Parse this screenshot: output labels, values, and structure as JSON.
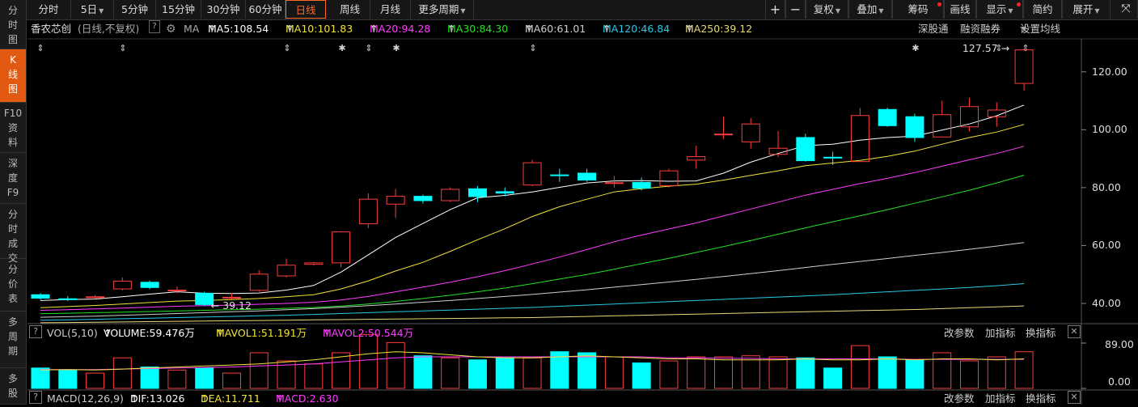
{
  "sidebar": {
    "items": [
      {
        "label": "分\n时\n图",
        "active": false
      },
      {
        "label": "K\n线\n图",
        "active": true
      },
      {
        "label": "F10\n资\n料",
        "active": false
      },
      {
        "label": "深\n度\nF9",
        "active": false
      },
      {
        "label": "分\n时\n成\n交",
        "active": false
      },
      {
        "label": "分\n价\n表",
        "active": false
      },
      {
        "label": "多\n周\n期",
        "active": false
      },
      {
        "label": "多\n股",
        "active": false
      }
    ]
  },
  "toolbar": {
    "periods": [
      "分时",
      "5日",
      "5分钟",
      "15分钟",
      "30分钟",
      "60分钟",
      "日线",
      "周线",
      "月线",
      "更多周期"
    ],
    "active_period": "日线",
    "right_buttons": [
      "+",
      "−",
      "复权",
      "叠加",
      "筹码",
      "画线",
      "显示",
      "简约",
      "展开"
    ]
  },
  "infobar": {
    "stock_name": "香农芯创",
    "mode": "(日线,不复权)",
    "help": "?",
    "ma_label": "MA",
    "ma": [
      {
        "text": "MA5:108.54",
        "color": "#ffffff"
      },
      {
        "text": "MA10:101.83",
        "color": "#f2e33a"
      },
      {
        "text": "MA20:94.28",
        "color": "#ff3dff"
      },
      {
        "text": "MA30:84.30",
        "color": "#25e025"
      },
      {
        "text": "MA60:61.01",
        "color": "#cfcfcf"
      },
      {
        "text": "MA120:46.84",
        "color": "#29c8e6"
      },
      {
        "text": "MA250:39.12",
        "color": "#e8d97a"
      }
    ],
    "links": [
      "深股通",
      "融资融券",
      "设置均线"
    ]
  },
  "price_axis": {
    "labels": [
      "120.00",
      "100.00",
      "80.00",
      "60.00",
      "40.00"
    ]
  },
  "price_annotations": {
    "high": "127.57",
    "low": "39.12"
  },
  "volume_panel": {
    "title": "VOL(5,10)",
    "volume": "VOLUME:59.476万",
    "mavol1": "MAVOL1:51.191万",
    "mavol2": "MAVOL2:50.544万",
    "links": [
      "改参数",
      "加指标",
      "换指标"
    ],
    "axis_labels": [
      "89.00",
      "0.00"
    ]
  },
  "macd_panel": {
    "title": "MACD(12,26,9)",
    "dif": "DIF:13.026",
    "dea": "DEA:11.711",
    "macd": "MACD:2.630",
    "links": [
      "改参数",
      "加指标",
      "换指标"
    ]
  },
  "colors": {
    "up": "#ff3d3d",
    "down": "#00ffff",
    "accent": "#ff6a2a"
  },
  "chart_data": {
    "type": "candlestick",
    "ylim": [
      33,
      130
    ],
    "candles": [
      {
        "o": 43.0,
        "c": 41.8,
        "h": 43.5,
        "l": 41.2
      },
      {
        "o": 41.6,
        "c": 41.4,
        "h": 42.5,
        "l": 40.8
      },
      {
        "o": 42.0,
        "c": 42.3,
        "h": 42.9,
        "l": 41.5
      },
      {
        "o": 45.0,
        "c": 47.7,
        "h": 48.9,
        "l": 44.5
      },
      {
        "o": 47.3,
        "c": 45.5,
        "h": 47.9,
        "l": 44.9
      },
      {
        "o": 44.5,
        "c": 44.6,
        "h": 45.8,
        "l": 43.5
      },
      {
        "o": 43.5,
        "c": 39.6,
        "h": 44.0,
        "l": 39.12
      },
      {
        "o": 42.0,
        "c": 42.1,
        "h": 43.5,
        "l": 41.4
      },
      {
        "o": 44.5,
        "c": 50.1,
        "h": 51.5,
        "l": 44.0
      },
      {
        "o": 49.5,
        "c": 53.2,
        "h": 55.5,
        "l": 49.0
      },
      {
        "o": 53.5,
        "c": 54.0,
        "h": 54.3,
        "l": 53.1
      },
      {
        "o": 54.0,
        "c": 64.7,
        "h": 65.0,
        "l": 52.5
      },
      {
        "o": 67.5,
        "c": 76.0,
        "h": 78.0,
        "l": 66.0
      },
      {
        "o": 74.3,
        "c": 77.0,
        "h": 79.5,
        "l": 69.5
      },
      {
        "o": 77.0,
        "c": 75.5,
        "h": 77.6,
        "l": 74.5
      },
      {
        "o": 75.5,
        "c": 79.4,
        "h": 80.1,
        "l": 75.0
      },
      {
        "o": 79.6,
        "c": 76.9,
        "h": 80.5,
        "l": 75.0
      },
      {
        "o": 78.6,
        "c": 78.1,
        "h": 80.1,
        "l": 77.0
      },
      {
        "o": 80.9,
        "c": 88.6,
        "h": 89.6,
        "l": 80.5
      },
      {
        "o": 84.4,
        "c": 84.2,
        "h": 86.5,
        "l": 82.0
      },
      {
        "o": 85.0,
        "c": 82.6,
        "h": 86.5,
        "l": 82.0
      },
      {
        "o": 81.5,
        "c": 81.7,
        "h": 84.0,
        "l": 80.0
      },
      {
        "o": 81.8,
        "c": 79.8,
        "h": 83.5,
        "l": 79.0
      },
      {
        "o": 80.7,
        "c": 85.8,
        "h": 86.5,
        "l": 80.0
      },
      {
        "o": 89.5,
        "c": 90.7,
        "h": 94.5,
        "l": 86.5
      },
      {
        "o": 98.5,
        "c": 98.5,
        "h": 104.5,
        "l": 96.8
      },
      {
        "o": 95.8,
        "c": 102.0,
        "h": 104.0,
        "l": 93.5
      },
      {
        "o": 91.5,
        "c": 93.6,
        "h": 99.5,
        "l": 90.5
      },
      {
        "o": 97.3,
        "c": 89.3,
        "h": 98.6,
        "l": 89.0
      },
      {
        "o": 90.5,
        "c": 90.3,
        "h": 92.4,
        "l": 87.8
      },
      {
        "o": 89.0,
        "c": 104.9,
        "h": 107.5,
        "l": 89.0
      },
      {
        "o": 107.0,
        "c": 101.4,
        "h": 107.6,
        "l": 101.0
      },
      {
        "o": 104.5,
        "c": 97.3,
        "h": 105.5,
        "l": 95.8
      },
      {
        "o": 97.5,
        "c": 105.2,
        "h": 110.0,
        "l": 97.3
      },
      {
        "o": 101.0,
        "c": 108.0,
        "h": 111.0,
        "l": 99.4
      },
      {
        "o": 104.5,
        "c": 106.8,
        "h": 109.5,
        "l": 101.0
      },
      {
        "o": 116.0,
        "c": 127.57,
        "h": 128.0,
        "l": 113.5
      }
    ],
    "ma5": [
      41.0,
      41.3,
      41.5,
      42.3,
      43.2,
      44.0,
      43.5,
      43.4,
      43.6,
      44.6,
      46.2,
      50.8,
      56.8,
      62.8,
      67.6,
      72.4,
      76.5,
      77.3,
      78.5,
      80.1,
      81.6,
      82.3,
      82.4,
      82.2,
      82.3,
      85.0,
      88.8,
      91.8,
      94.5,
      95.0,
      96.4,
      97.3,
      97.8,
      99.9,
      102.0,
      104.8,
      108.54
    ],
    "ma10": [
      38.5,
      38.9,
      39.3,
      39.8,
      40.3,
      40.8,
      41.0,
      41.3,
      41.7,
      42.3,
      43.0,
      45.0,
      47.8,
      51.2,
      54.2,
      58.0,
      62.0,
      65.8,
      70.0,
      73.4,
      76.0,
      78.5,
      79.6,
      80.5,
      81.2,
      82.6,
      84.2,
      85.8,
      87.6,
      88.5,
      89.4,
      90.8,
      92.6,
      95.0,
      97.3,
      99.2,
      101.83
    ],
    "ma20": [
      37.6,
      37.8,
      38.1,
      38.4,
      38.7,
      39.0,
      39.2,
      39.4,
      39.7,
      40.0,
      40.4,
      41.2,
      42.4,
      44.0,
      45.6,
      47.3,
      49.2,
      51.3,
      53.6,
      56.0,
      58.6,
      61.3,
      63.6,
      65.7,
      67.8,
      70.2,
      72.6,
      75.0,
      77.4,
      79.4,
      81.4,
      83.2,
      85.2,
      87.4,
      89.6,
      91.8,
      94.28
    ],
    "ma30": [
      36.4,
      36.6,
      36.8,
      37.0,
      37.2,
      37.4,
      37.6,
      37.8,
      38.0,
      38.3,
      38.6,
      39.1,
      39.8,
      40.7,
      41.7,
      42.8,
      44.0,
      45.3,
      46.8,
      48.4,
      50.0,
      51.8,
      53.7,
      55.6,
      57.6,
      59.6,
      61.7,
      63.9,
      66.1,
      68.2,
      70.3,
      72.4,
      74.6,
      76.8,
      79.1,
      81.6,
      84.3
    ],
    "ma60": [
      35.2,
      35.4,
      35.6,
      35.9,
      36.2,
      36.5,
      36.8,
      37.1,
      37.4,
      37.8,
      38.2,
      38.7,
      39.2,
      39.8,
      40.4,
      41.0,
      41.7,
      42.4,
      43.1,
      43.9,
      44.7,
      45.6,
      46.5,
      47.4,
      48.3,
      49.3,
      50.3,
      51.3,
      52.4,
      53.5,
      54.5,
      55.5,
      56.6,
      57.6,
      58.7,
      59.8,
      61.01
    ],
    "ma120": [
      34.2,
      34.3,
      34.5,
      34.7,
      34.9,
      35.1,
      35.3,
      35.5,
      35.7,
      35.9,
      36.2,
      36.5,
      36.8,
      37.1,
      37.4,
      37.7,
      38.0,
      38.3,
      38.6,
      39.0,
      39.4,
      39.8,
      40.2,
      40.6,
      41.0,
      41.4,
      41.8,
      42.2,
      42.6,
      43.0,
      43.5,
      44.0,
      44.5,
      45.0,
      45.5,
      46.1,
      46.84
    ],
    "ma250": [
      33.3,
      33.4,
      33.5,
      33.6,
      33.7,
      33.8,
      33.9,
      34.0,
      34.1,
      34.2,
      34.3,
      34.4,
      34.5,
      34.6,
      34.7,
      34.8,
      34.9,
      35.0,
      35.1,
      35.3,
      35.5,
      35.7,
      35.9,
      36.1,
      36.3,
      36.5,
      36.7,
      36.9,
      37.1,
      37.3,
      37.5,
      37.7,
      37.9,
      38.2,
      38.5,
      38.8,
      39.12
    ],
    "volume": {
      "ylim": [
        0,
        89
      ],
      "values": [
        40,
        36,
        30,
        60,
        42,
        36,
        40,
        30,
        70,
        54,
        48,
        70,
        106,
        90,
        64,
        60,
        56,
        60,
        60,
        72,
        70,
        62,
        50,
        54,
        62,
        62,
        64,
        62,
        60,
        40,
        84,
        62,
        56,
        70,
        54,
        62,
        72
      ],
      "mavol1": [
        36,
        37,
        36,
        38,
        40,
        42,
        44,
        46,
        48,
        52,
        56,
        62,
        68,
        72,
        70,
        66,
        62,
        60,
        60,
        62,
        64,
        62,
        60,
        58,
        58,
        56,
        56,
        56,
        58,
        56,
        56,
        58,
        56,
        58,
        58,
        56,
        58
      ],
      "mavol2": [
        37,
        37,
        37,
        38,
        39,
        40,
        41,
        42,
        44,
        46,
        48,
        52,
        56,
        60,
        62,
        62,
        62,
        62,
        62,
        62,
        62,
        62,
        62,
        60,
        60,
        59,
        59,
        58,
        58,
        58,
        58,
        58,
        57,
        57,
        57,
        57,
        57
      ]
    }
  }
}
